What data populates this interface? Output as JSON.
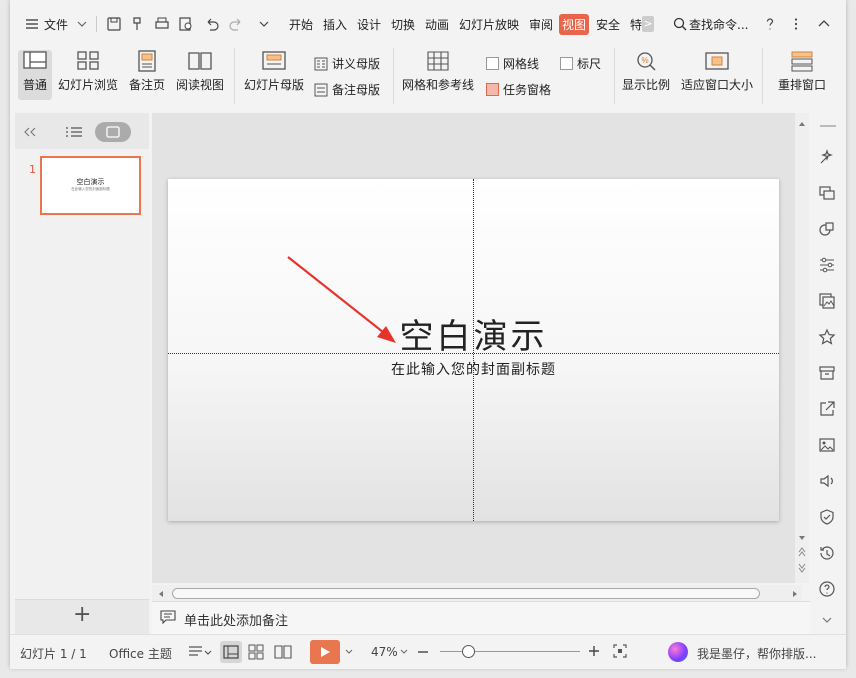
{
  "menubar": {
    "file_label": "文件",
    "tabs": [
      "开始",
      "插入",
      "设计",
      "切换",
      "动画",
      "幻灯片放映",
      "审阅",
      "视图",
      "安全",
      "特"
    ],
    "active_tab": "视图",
    "search_label": "查找命令...",
    "more_glyph": ">"
  },
  "ribbon": {
    "normal_label": "普通",
    "slide_sorter_label": "幻灯片浏览",
    "notes_page_label": "备注页",
    "reading_view_label": "阅读视图",
    "slide_master_label": "幻灯片母版",
    "handout_master_label": "讲义母版",
    "notes_master_label": "备注母版",
    "grid_guides_label": "网格和参考线",
    "gridlines_label": "网格线",
    "ruler_label": "标尺",
    "task_pane_label": "任务窗格",
    "zoom_label": "显示比例",
    "fit_window_label": "适应窗口大小",
    "arrange_label": "重排窗口"
  },
  "ribbon_state": {
    "gridlines_checked": false,
    "ruler_checked": false,
    "task_pane_checked": true
  },
  "thumbnails": {
    "items": [
      {
        "number": "1",
        "title": "空白演示",
        "subtitle": "在此输入您的封面副标题"
      }
    ],
    "add_glyph": "+"
  },
  "slide": {
    "title": "空白演示",
    "subtitle": "在此输入您的封面副标题"
  },
  "notes": {
    "placeholder": "单击此处添加备注"
  },
  "status": {
    "slide_counter": "幻灯片 1 / 1",
    "theme": "Office 主题",
    "zoom": "47%",
    "assistant_text": "我是墨仔，帮你排版..."
  },
  "colors": {
    "accent": "#e8654c",
    "thumbnail_border": "#e8774f",
    "arrow": "#e8332c"
  }
}
